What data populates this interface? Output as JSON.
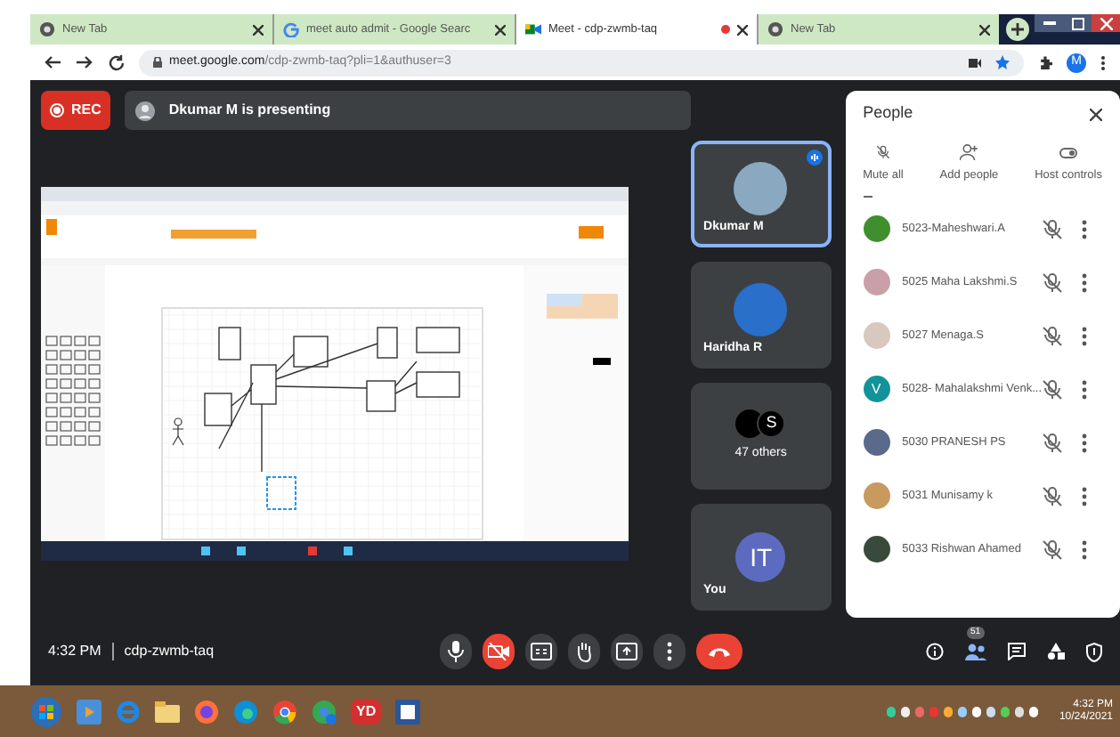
{
  "browser": {
    "tabs": [
      {
        "title": "New Tab",
        "kind": "chrome",
        "selected": false
      },
      {
        "title": "meet auto admit - Google Searc",
        "kind": "google",
        "selected": false
      },
      {
        "title": "Meet - cdp-zwmb-taq",
        "kind": "meet",
        "selected": true,
        "recording": true
      },
      {
        "title": "New Tab",
        "kind": "chrome",
        "selected": false
      }
    ],
    "url_host": "meet.google.com",
    "url_path": "/cdp-zwmb-taq?pli=1&authuser=3",
    "profile_initial": "M"
  },
  "meeting": {
    "rec_label": "REC",
    "presenting": "Dkumar M is presenting",
    "tiles": [
      {
        "kind": "photo",
        "name": "Dkumar M",
        "speaking": true,
        "color": "#8aa8c0"
      },
      {
        "kind": "photo",
        "name": "Haridha R",
        "speaking": false,
        "color": "#2a6fc9"
      },
      {
        "kind": "others",
        "label": "47 others",
        "initial": "S",
        "speaking": false
      },
      {
        "kind": "initial",
        "name": "You",
        "initial": "IT",
        "speaking": false,
        "color": "#5c6bc0"
      }
    ],
    "people": {
      "title": "People",
      "actions": [
        "Mute all",
        "Add people",
        "Host controls"
      ],
      "participants": [
        {
          "name": "5023-Maheshwari.A",
          "color": "#3f8f2f"
        },
        {
          "name": "5025 Maha Lakshmi.S",
          "color": "#c9a0a8"
        },
        {
          "name": "5027 Menaga.S",
          "color": "#d8c8c0"
        },
        {
          "name": "5028- Mahalakshmi Venk...",
          "color": "#12939a",
          "initial": "V"
        },
        {
          "name": "5030 PRANESH PS",
          "color": "#5a6a8a"
        },
        {
          "name": "5031 Munisamy k",
          "color": "#c89a60"
        },
        {
          "name": "5033 Rishwan Ahamed",
          "color": "#3a4a3a"
        }
      ]
    },
    "time": "4:32 PM",
    "code": "cdp-zwmb-taq",
    "controls": [
      {
        "kind": "mic",
        "off": false
      },
      {
        "kind": "camera",
        "off": true
      },
      {
        "kind": "captions",
        "off": false
      },
      {
        "kind": "hand",
        "off": false
      },
      {
        "kind": "present",
        "off": false
      },
      {
        "kind": "more",
        "off": false
      },
      {
        "kind": "hangup"
      }
    ],
    "participant_count": "51"
  },
  "taskbar": {
    "apps": [
      {
        "kind": "start"
      },
      {
        "kind": "media"
      },
      {
        "kind": "ie"
      },
      {
        "kind": "files"
      },
      {
        "kind": "firefox"
      },
      {
        "kind": "edge"
      },
      {
        "kind": "chrome"
      },
      {
        "kind": "chrome2"
      },
      {
        "kind": "yd",
        "label": "YD"
      },
      {
        "kind": "word"
      }
    ],
    "time": "4:32 PM",
    "date": "10/24/2021"
  }
}
